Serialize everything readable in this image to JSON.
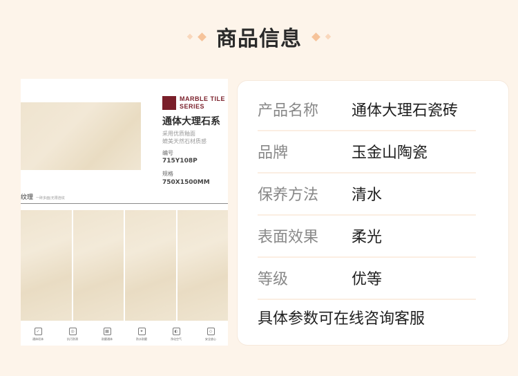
{
  "header": {
    "title": "商品信息"
  },
  "product_image": {
    "series_line1": "MARBLE TILE",
    "series_line2": "SERIES",
    "series_title": "通体大理石系",
    "desc_line1": "采用优质釉面",
    "desc_line2": "媲美天然石材质感",
    "code_label": "编号",
    "code_value": "715Y108P",
    "size_label": "规格",
    "size_value": "750X1500MM",
    "texture_label": "纹理",
    "texture_sub": "一砖多面|无限连纹",
    "features": [
      {
        "icon": "✓",
        "label": "通体坯体"
      },
      {
        "icon": "◎",
        "label": "抗污防滑"
      },
      {
        "icon": "▦",
        "label": "耐磨通体"
      },
      {
        "icon": "✦",
        "label": "防水耐磨"
      },
      {
        "icon": "◐",
        "label": "净化空气"
      },
      {
        "icon": "◇",
        "label": "安全放心"
      }
    ]
  },
  "info": {
    "rows": [
      {
        "label": "产品名称",
        "value": "通体大理石瓷砖"
      },
      {
        "label": "品牌",
        "value": "玉金山陶瓷"
      },
      {
        "label": "保养方法",
        "value": "清水"
      },
      {
        "label": "表面效果",
        "value": "柔光"
      },
      {
        "label": "等级",
        "value": "优等"
      }
    ],
    "note": "具体参数可在线咨询客服"
  },
  "colors": {
    "background": "#fdf4ea",
    "accent": "#f6c39a",
    "brand": "#7a1f2a"
  }
}
